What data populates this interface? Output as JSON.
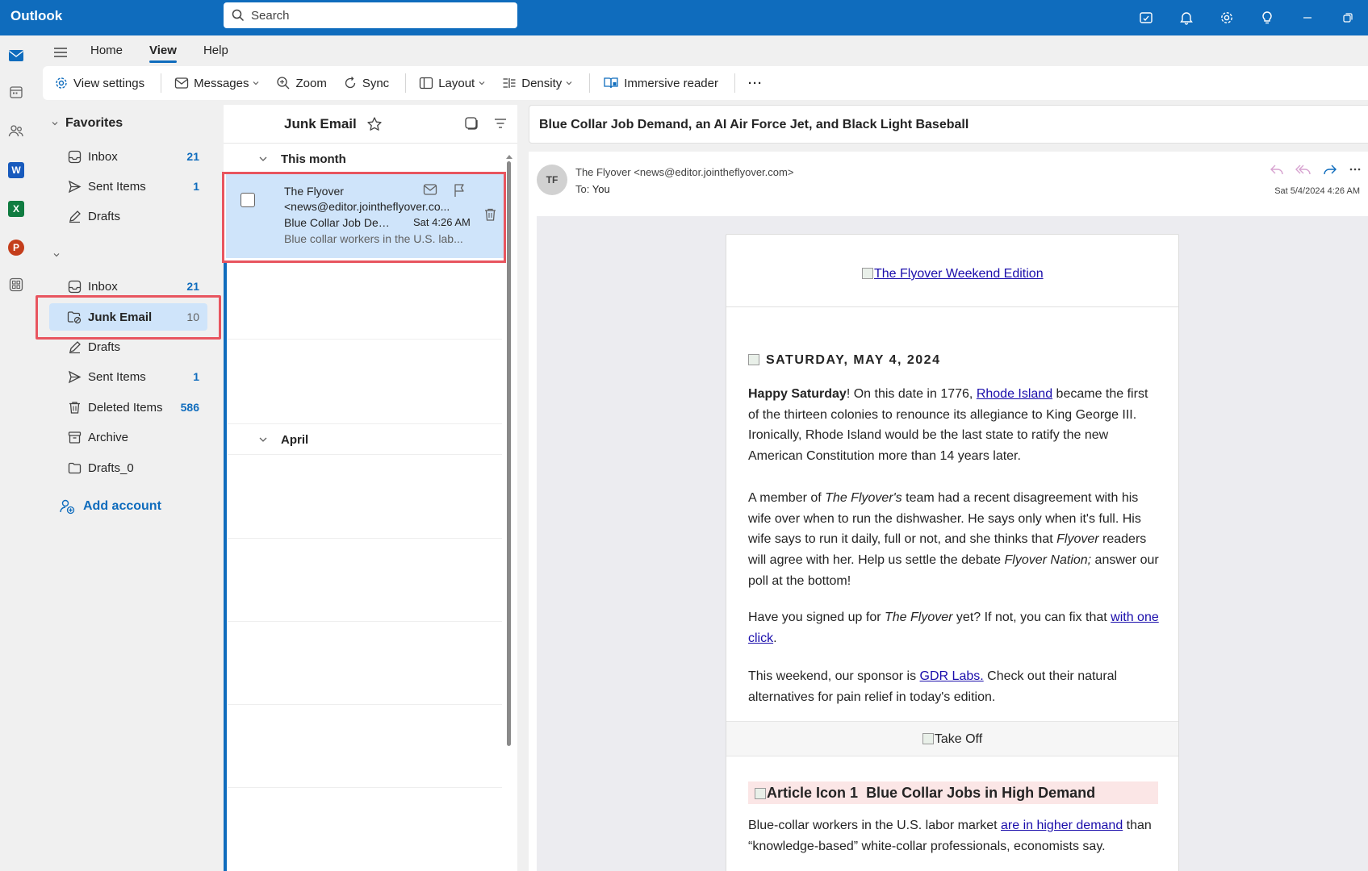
{
  "app": {
    "title": "Outlook"
  },
  "search": {
    "placeholder": "Search"
  },
  "menu": {
    "tabs": [
      "Home",
      "View",
      "Help"
    ],
    "active": "View"
  },
  "ribbon": {
    "view_settings": "View settings",
    "messages": "Messages",
    "zoom": "Zoom",
    "sync": "Sync",
    "layout": "Layout",
    "density": "Density",
    "immersive_reader": "Immersive reader",
    "more": "···"
  },
  "folders": {
    "favorites_label": "Favorites",
    "favorites": [
      {
        "name": "Inbox",
        "count": "21"
      },
      {
        "name": "Sent Items",
        "count": "1"
      },
      {
        "name": "Drafts",
        "count": ""
      }
    ],
    "account": [
      {
        "name": "Inbox",
        "count": "21"
      },
      {
        "name": "Junk Email",
        "count": "10"
      },
      {
        "name": "Drafts",
        "count": ""
      },
      {
        "name": "Sent Items",
        "count": "1"
      },
      {
        "name": "Deleted Items",
        "count": "586"
      },
      {
        "name": "Archive",
        "count": ""
      },
      {
        "name": "Drafts_0",
        "count": ""
      }
    ],
    "selected": "Junk Email",
    "add_account": "Add account"
  },
  "message_list": {
    "title": "Junk Email",
    "groups": [
      "This month",
      "April"
    ],
    "messages": [
      {
        "sender": "The Flyover",
        "email": "<news@editor.jointheflyover.co...",
        "subject": "Blue Collar Job Dem...",
        "time": "Sat 4:26 AM",
        "preview": "Blue collar workers in the U.S. lab..."
      }
    ]
  },
  "reading": {
    "subject": "Blue Collar Job Demand, an AI Air Force Jet, and Black Light Baseball",
    "avatar_initials": "TF",
    "from": "The Flyover <news@editor.jointheflyover.com>",
    "to_label": "To:",
    "to": "You",
    "date": "Sat 5/4/2024 4:26 AM",
    "body": {
      "header_link": "The Flyover Weekend Edition",
      "date_heading": "SATURDAY, MAY 4, 2024",
      "p1_bold": "Happy Saturday",
      "p1_a": "! On this date in 1776, ",
      "p1_link": "Rhode Island",
      "p1_b": " became the first of the thirteen colonies to renounce its allegiance to King George III. Ironically, Rhode Island would be the last state to ratify the new American Constitution more than 14 years later.",
      "p2_a": "A member of ",
      "p2_i1": "The Flyover's",
      "p2_b": " team had a recent disagreement with his wife over when to run the dishwasher. He says only when it's full. His wife says to run it daily, full or not, and she thinks that  ",
      "p2_i2": "Flyover",
      "p2_c": " readers will agree with her. Help us settle the debate ",
      "p2_i3": "Flyover Nation;",
      "p2_d": " answer our poll at the bottom!",
      "p3_a": "Have you signed up for ",
      "p3_i": "The Flyover",
      "p3_b": " yet? If not, you can fix that ",
      "p3_link": "with one click",
      "p3_c": ".",
      "p4_a": "This weekend, our sponsor is ",
      "p4_link": "GDR Labs.",
      "p4_b": " Check out their natural alternatives for pain relief in today's edition.",
      "takeoff_alt": "Take Off",
      "article_icon_alt": "Article Icon 1",
      "article_title": "Blue Collar Jobs in High Demand",
      "p5_a": "Blue-collar workers in the U.S. labor market ",
      "p5_link": "are in higher demand",
      "p5_b": " than “knowledge-based” white-collar professionals, economists say."
    }
  },
  "colors": {
    "brand": "#0f6cbd",
    "selected": "#cfe4fa",
    "highlight": "#e8555f"
  }
}
